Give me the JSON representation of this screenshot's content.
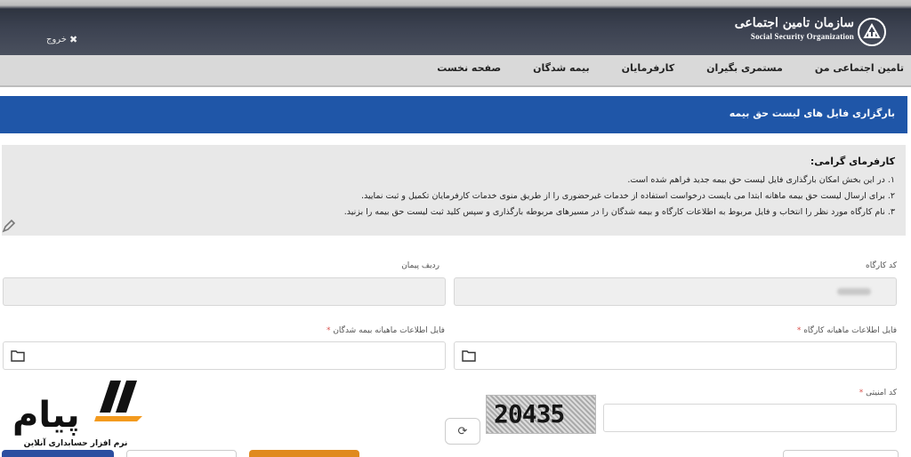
{
  "header": {
    "logout_label": "خروج",
    "org_name_fa": "سازمان تامین اجتماعی",
    "org_name_en": "Social Security Organization"
  },
  "nav": {
    "items": [
      {
        "label": "صفحه نخست"
      },
      {
        "label": "بیمه شدگان"
      },
      {
        "label": "کارفرمایان"
      },
      {
        "label": "مستمری بگیران"
      },
      {
        "label": "تامین اجتماعی من"
      }
    ]
  },
  "page_title": "بارگزاری فایل های لیست حق بیمه",
  "notice": {
    "heading": "کارفرمای گرامی:",
    "lines": [
      "۱. در این بخش امکان بارگذاری فایل لیست حق بیمه جدید فراهم شده است.",
      "۲. برای ارسال لیست حق بیمه ماهانه ابتدا می بایست درخواست استفاده از خدمات غیرحضوری را از طریق منوی خدمات کارفرمایان تکمیل و ثبت نمایید.",
      "۳. نام کارگاه مورد نظر را انتخاب و فایل مربوط به اطلاعات کارگاه و بیمه شدگان را در مسیرهای مربوطه بارگذاری و سپس کلید ثبت لیست حق بیمه را بزنید."
    ]
  },
  "form": {
    "workshop_code_label": "کد کارگاه",
    "contract_row_label": "ردیف پیمان",
    "workshop_file_label": "فایل اطلاعات ماهیانه کارگاه",
    "insured_file_label": "فایل اطلاعات ماهیانه بیمه شدگان",
    "security_code_label": "کد امنیتی",
    "required_mark": "*"
  },
  "captcha": {
    "text": "20435"
  },
  "brand": {
    "name": "پیام",
    "tagline": "نرم افزار حسابداری آنلاین"
  },
  "colors": {
    "title_bar": "#1f56a8",
    "required": "#d9534f",
    "brand_accent": "#f39a1e",
    "bottom_primary": "#2b4ea0",
    "bottom_warning": "#e08a1e"
  }
}
